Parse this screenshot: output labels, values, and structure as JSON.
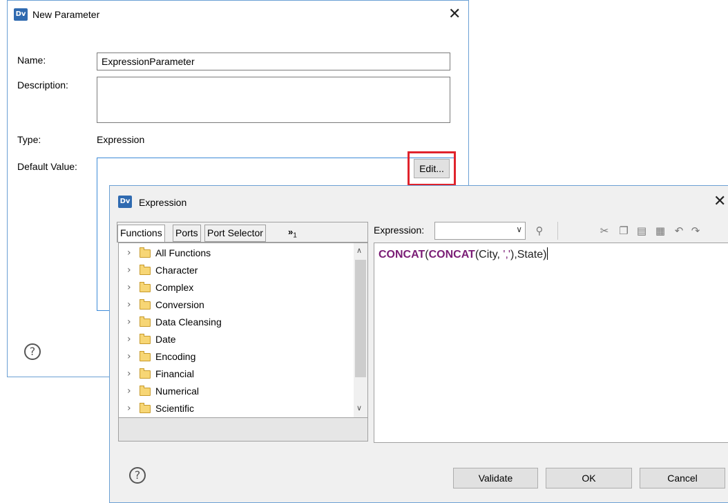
{
  "new_parameter": {
    "logo": "Dv",
    "title": "New Parameter",
    "close": "✕",
    "name_label": "Name:",
    "name_value": "ExpressionParameter",
    "description_label": "Description:",
    "description_value": "",
    "type_label": "Type:",
    "type_value": "Expression",
    "default_label": "Default Value:",
    "edit_button": "Edit...",
    "help": "?"
  },
  "expression": {
    "logo": "Dv",
    "title": "Expression",
    "close": "✕",
    "tabs": [
      "Functions",
      "Ports",
      "Port Selector"
    ],
    "more_tabs": "»",
    "more_count": "1",
    "functions": [
      "All Functions",
      "Character",
      "Complex",
      "Conversion",
      "Data Cleansing",
      "Date",
      "Encoding",
      "Financial",
      "Numerical",
      "Scientific"
    ],
    "expression_label": "Expression:",
    "expression_combo_value": "",
    "code": {
      "kw1": "CONCAT",
      "p1": "(",
      "kw2": "CONCAT",
      "p2": "(City, ",
      "str": "','",
      "p3": "),State)"
    },
    "buttons": {
      "validate": "Validate",
      "ok": "OK",
      "cancel": "Cancel"
    },
    "help": "?"
  },
  "icons": {
    "expression_toolbar": [
      "binoculars-icon",
      "cut-icon",
      "copy-icon",
      "paste-icon",
      "paste-special-icon",
      "undo-icon",
      "redo-icon"
    ],
    "folder": "folder-icon"
  },
  "colors": {
    "highlight": "#e0232c",
    "keyword": "#7a1c75",
    "border_blue": "#3c8ad8"
  }
}
